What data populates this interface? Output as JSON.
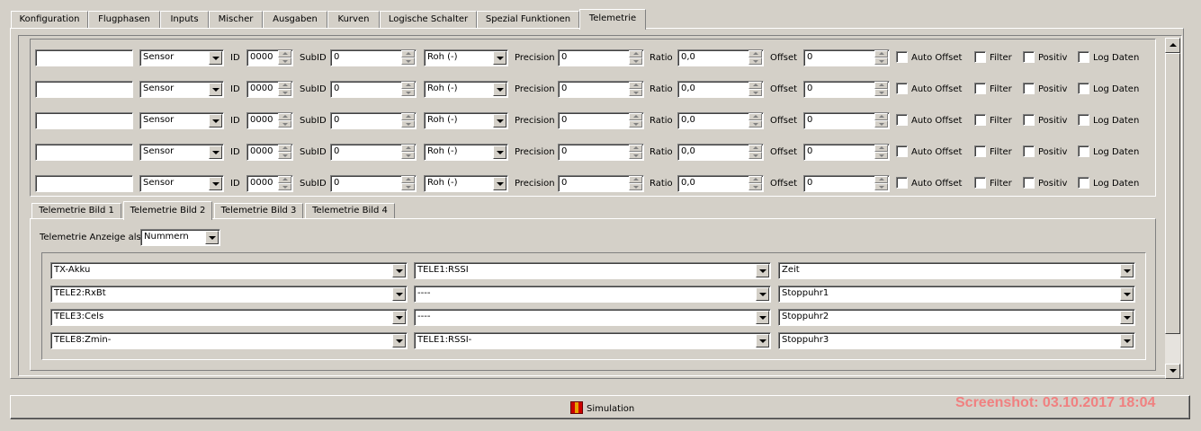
{
  "tabs": [
    "Konfiguration",
    "Flugphasen",
    "Inputs",
    "Mischer",
    "Ausgaben",
    "Kurven",
    "Logische Schalter",
    "Spezial Funktionen",
    "Telemetrie"
  ],
  "active_tab": "Telemetrie",
  "sensor_labels": {
    "id": "ID",
    "subid": "SubID",
    "precision": "Precision",
    "ratio": "Ratio",
    "offset": "Offset",
    "auto_offset": "Auto Offset",
    "filter": "Filter",
    "positiv": "Positiv",
    "log_daten": "Log Daten"
  },
  "sensors": [
    {
      "name": "",
      "type": "Sensor",
      "id": "0000",
      "subid": "0",
      "unit": "Roh (-)",
      "precision": "0",
      "ratio": "0,0",
      "offset": "0",
      "auto_offset": false,
      "filter": false,
      "positiv": false,
      "log_daten": false
    },
    {
      "name": "",
      "type": "Sensor",
      "id": "0000",
      "subid": "0",
      "unit": "Roh (-)",
      "precision": "0",
      "ratio": "0,0",
      "offset": "0",
      "auto_offset": false,
      "filter": false,
      "positiv": false,
      "log_daten": false
    },
    {
      "name": "",
      "type": "Sensor",
      "id": "0000",
      "subid": "0",
      "unit": "Roh (-)",
      "precision": "0",
      "ratio": "0,0",
      "offset": "0",
      "auto_offset": false,
      "filter": false,
      "positiv": false,
      "log_daten": false
    },
    {
      "name": "",
      "type": "Sensor",
      "id": "0000",
      "subid": "0",
      "unit": "Roh (-)",
      "precision": "0",
      "ratio": "0,0",
      "offset": "0",
      "auto_offset": false,
      "filter": false,
      "positiv": false,
      "log_daten": false
    },
    {
      "name": "",
      "type": "Sensor",
      "id": "0000",
      "subid": "0",
      "unit": "Roh (-)",
      "precision": "0",
      "ratio": "0,0",
      "offset": "0",
      "auto_offset": false,
      "filter": false,
      "positiv": false,
      "log_daten": false
    }
  ],
  "screen_tabs": [
    "Telemetrie Bild 1",
    "Telemetrie Bild 2",
    "Telemetrie Bild 3",
    "Telemetrie Bild 4"
  ],
  "active_screen_tab": "Telemetrie Bild 2",
  "display_label": "Telemetrie Anzeige als",
  "display_mode": "Nummern",
  "screen_grid": [
    [
      "TX-Akku",
      "TELE1:RSSI",
      "Zeit"
    ],
    [
      "TELE2:RxBt",
      "----",
      "Stoppuhr1"
    ],
    [
      "TELE3:Cels",
      "----",
      "Stoppuhr2"
    ],
    [
      "TELE8:Zmin-",
      "TELE1:RSSI-",
      "Stoppuhr3"
    ]
  ],
  "simulation_label": "Simulation",
  "screenshot_stamp": "Screenshot: 03.10.2017 18:04",
  "colors": {
    "window_bg": "#d4d0c8",
    "stamp": "#f08080"
  }
}
